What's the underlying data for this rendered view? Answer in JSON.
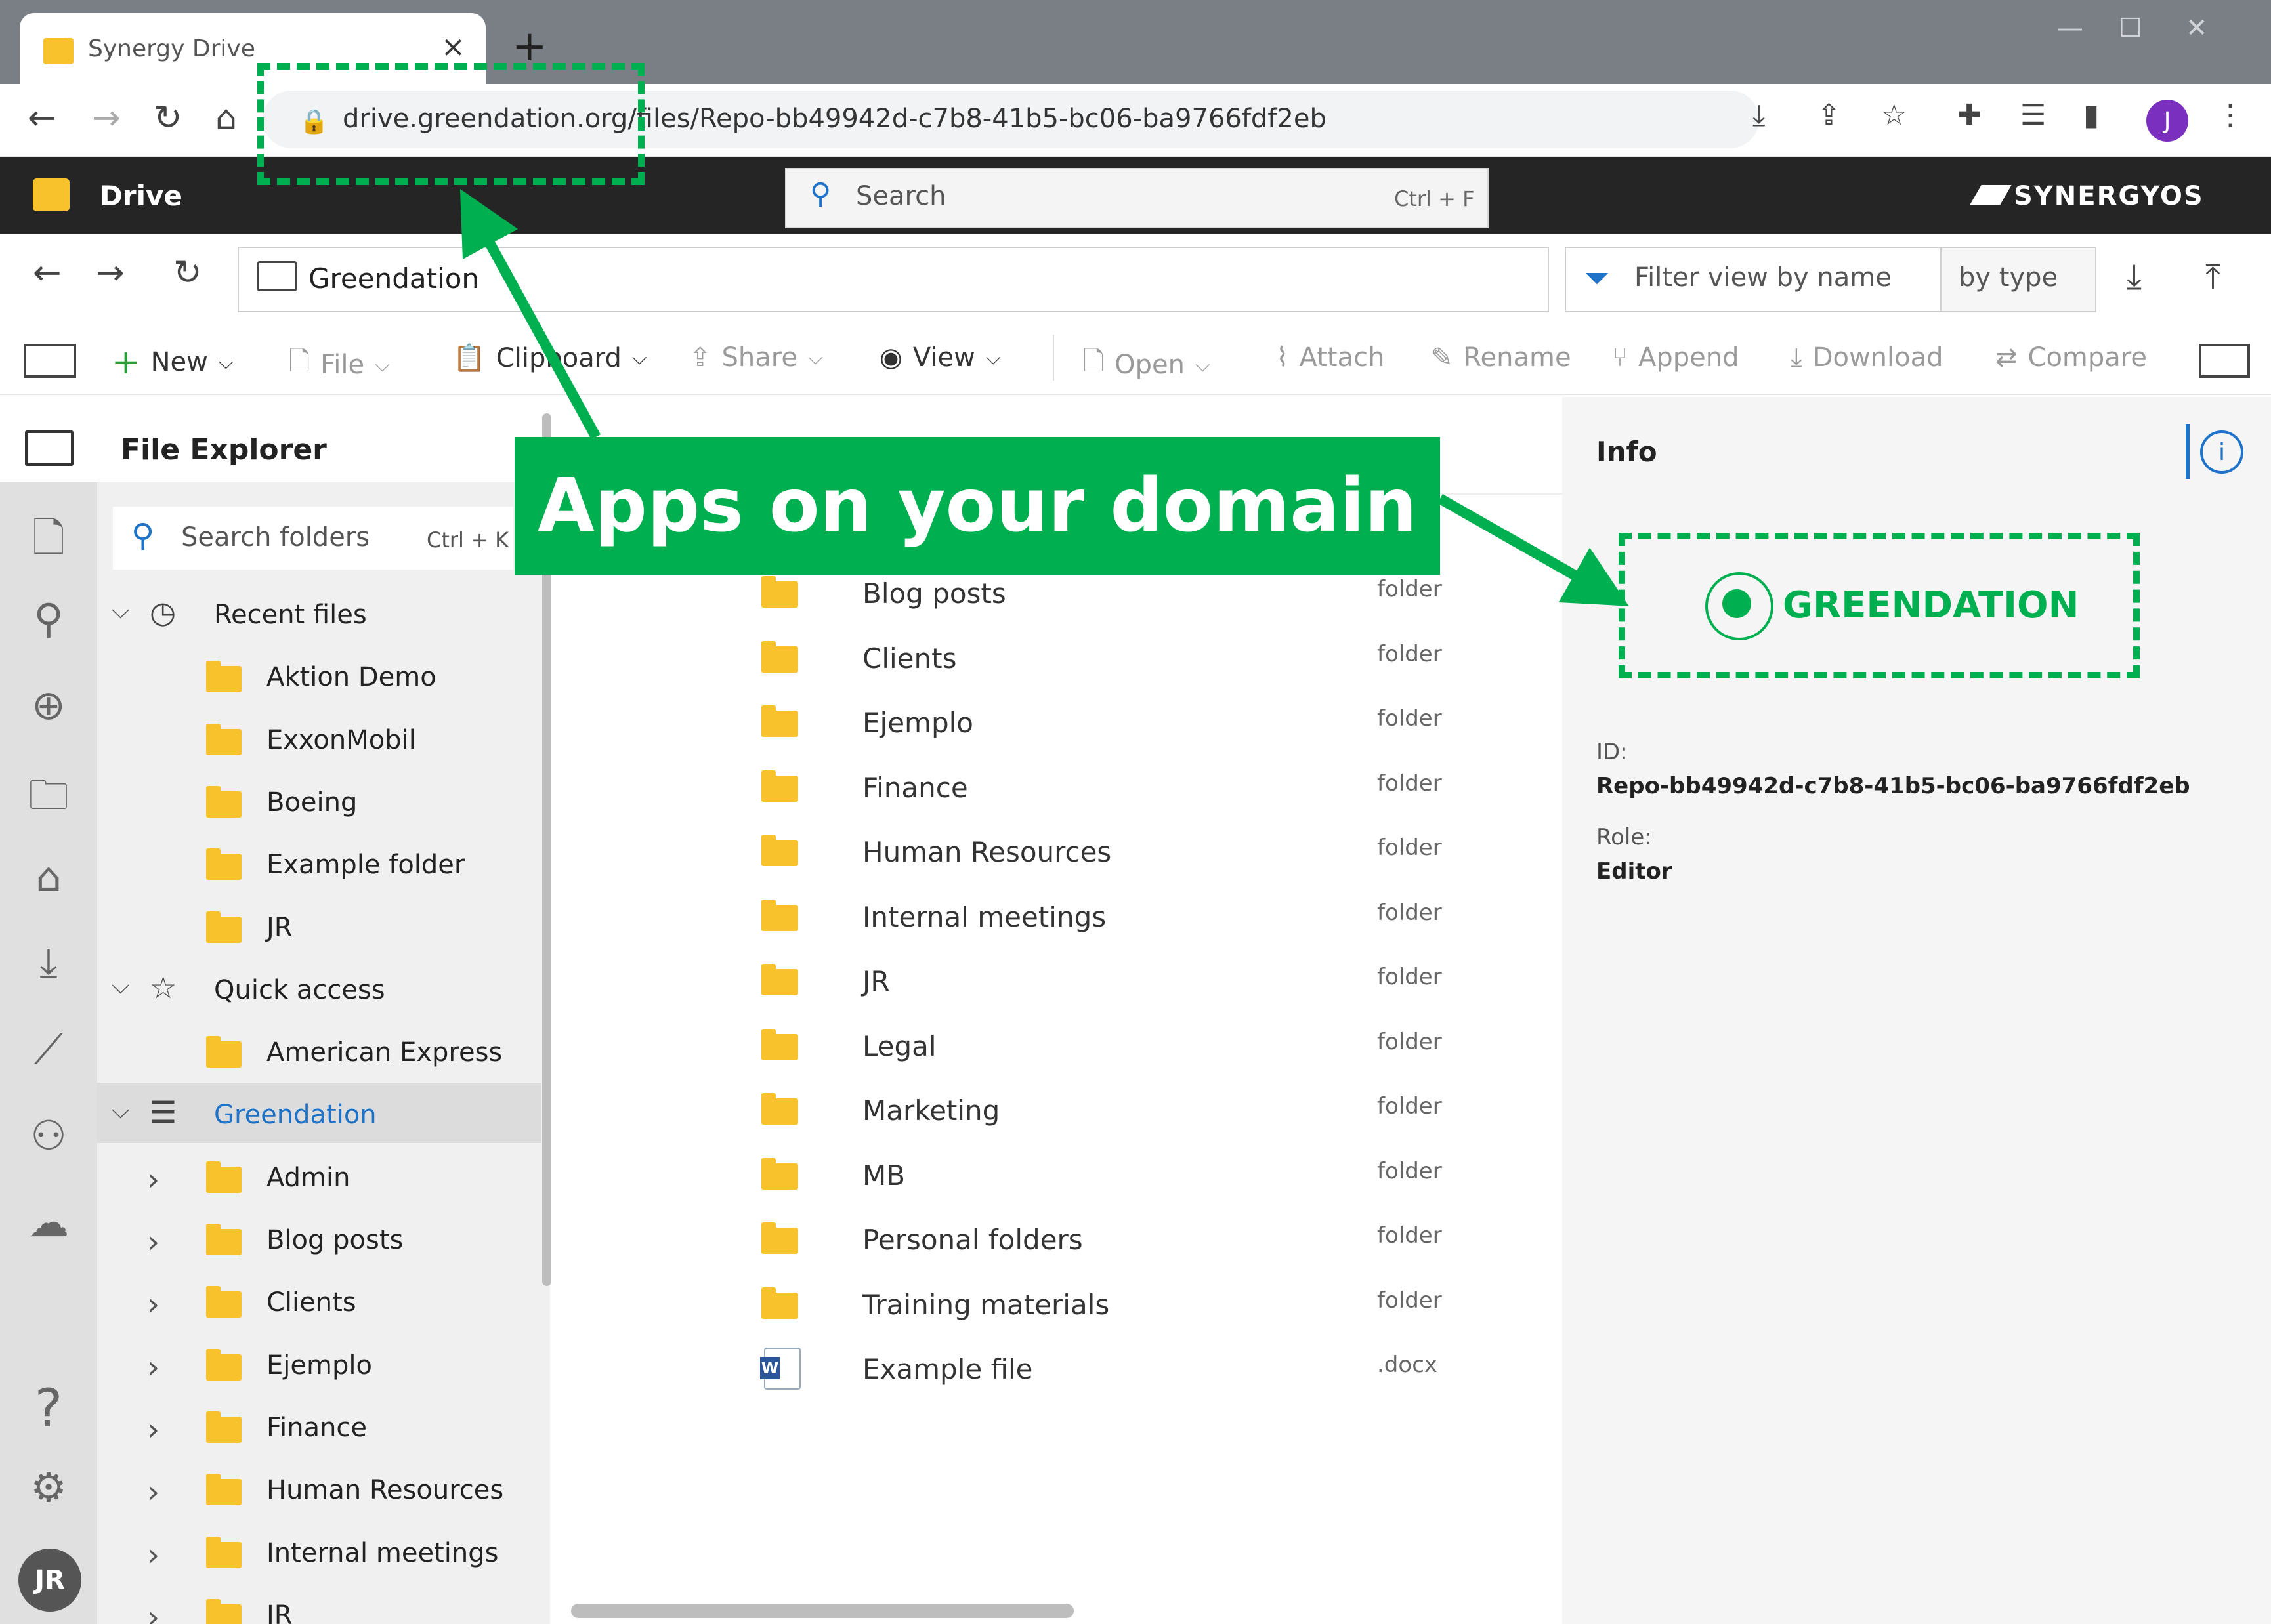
{
  "browser": {
    "tab_title": "Synergy Drive",
    "tab_close": "×",
    "new_tab": "+",
    "url": "drive.greendation.org/files/Repo-bb49942d-c7b8-41b5-bc06-ba9766fdf2eb",
    "profile_initial": "J"
  },
  "app": {
    "title": "Drive",
    "search_placeholder": "Search",
    "search_shortcut": "Ctrl + F",
    "brand": "SYNERGYOS"
  },
  "path": {
    "current": "Greendation",
    "filter_placeholder": "Filter view by name",
    "filter_type": "by type"
  },
  "toolbar": {
    "new": "New",
    "file": "File",
    "clipboard": "Clipboard",
    "share": "Share",
    "view": "View",
    "open": "Open",
    "attach": "Attach",
    "rename": "Rename",
    "append": "Append",
    "download": "Download",
    "compare": "Compare"
  },
  "explorer": {
    "title": "File Explorer",
    "search_placeholder": "Search folders",
    "search_shortcut": "Ctrl + K",
    "recent_label": "Recent files",
    "recent_items": [
      "Aktion Demo",
      "ExxonMobil",
      "Boeing",
      "Example folder",
      "JR"
    ],
    "quick_label": "Quick access",
    "quick_items": [
      "American Express"
    ],
    "repo_label": "Greendation",
    "repo_items": [
      "Admin",
      "Blog posts",
      "Clients",
      "Ejemplo",
      "Finance",
      "Human Resources",
      "Internal meetings",
      "JR"
    ],
    "user_initials": "JR"
  },
  "files": [
    {
      "name": "Blog posts",
      "type": "folder"
    },
    {
      "name": "Clients",
      "type": "folder"
    },
    {
      "name": "Ejemplo",
      "type": "folder"
    },
    {
      "name": "Finance",
      "type": "folder"
    },
    {
      "name": "Human Resources",
      "type": "folder"
    },
    {
      "name": "Internal meetings",
      "type": "folder"
    },
    {
      "name": "JR",
      "type": "folder"
    },
    {
      "name": "Legal",
      "type": "folder"
    },
    {
      "name": "Marketing",
      "type": "folder"
    },
    {
      "name": "MB",
      "type": "folder"
    },
    {
      "name": "Personal folders",
      "type": "folder"
    },
    {
      "name": "Training materials",
      "type": "folder"
    },
    {
      "name": "Example file",
      "type": ".docx"
    }
  ],
  "info": {
    "title": "Info",
    "brand": "GREENDATION",
    "id_label": "ID:",
    "id_value": "Repo-bb49942d-c7b8-41b5-bc06-ba9766fdf2eb",
    "role_label": "Role:",
    "role_value": "Editor"
  },
  "annotation": {
    "callout": "Apps on your domain",
    "color": "#00b050"
  }
}
